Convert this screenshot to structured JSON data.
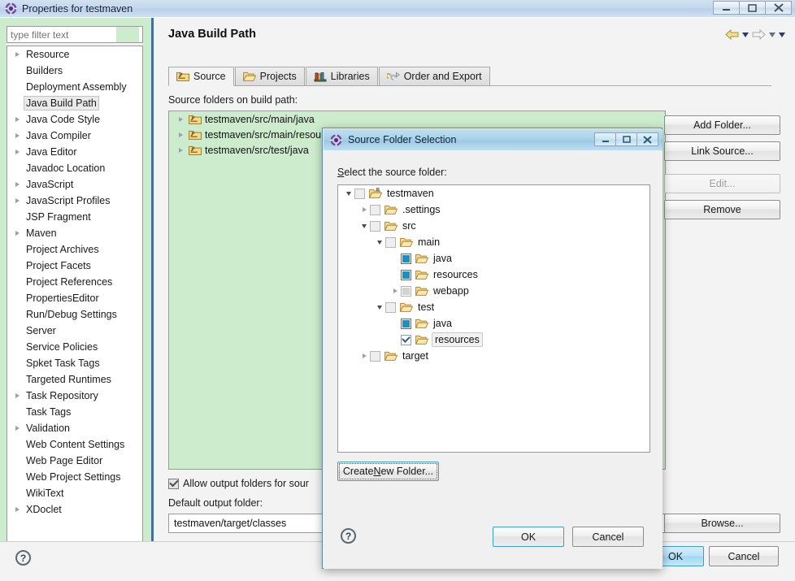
{
  "window": {
    "title": "Properties for testmaven",
    "icon": "eclipse-properties-icon",
    "minimize": "–",
    "maximize": "□",
    "close": "✕"
  },
  "filter": {
    "placeholder": "type filter text",
    "value": ""
  },
  "sidebar": {
    "items": [
      {
        "label": "Resource",
        "expandable": true,
        "selected": false
      },
      {
        "label": "Builders",
        "expandable": false,
        "selected": false
      },
      {
        "label": "Deployment Assembly",
        "expandable": false,
        "selected": false
      },
      {
        "label": "Java Build Path",
        "expandable": false,
        "selected": true
      },
      {
        "label": "Java Code Style",
        "expandable": true,
        "selected": false
      },
      {
        "label": "Java Compiler",
        "expandable": true,
        "selected": false
      },
      {
        "label": "Java Editor",
        "expandable": true,
        "selected": false
      },
      {
        "label": "Javadoc Location",
        "expandable": false,
        "selected": false
      },
      {
        "label": "JavaScript",
        "expandable": true,
        "selected": false
      },
      {
        "label": "JavaScript Profiles",
        "expandable": true,
        "selected": false
      },
      {
        "label": "JSP Fragment",
        "expandable": false,
        "selected": false
      },
      {
        "label": "Maven",
        "expandable": true,
        "selected": false
      },
      {
        "label": "Project Archives",
        "expandable": false,
        "selected": false
      },
      {
        "label": "Project Facets",
        "expandable": false,
        "selected": false
      },
      {
        "label": "Project References",
        "expandable": false,
        "selected": false
      },
      {
        "label": "PropertiesEditor",
        "expandable": false,
        "selected": false
      },
      {
        "label": "Run/Debug Settings",
        "expandable": false,
        "selected": false
      },
      {
        "label": "Server",
        "expandable": false,
        "selected": false
      },
      {
        "label": "Service Policies",
        "expandable": false,
        "selected": false
      },
      {
        "label": "Spket Task Tags",
        "expandable": false,
        "selected": false
      },
      {
        "label": "Targeted Runtimes",
        "expandable": false,
        "selected": false
      },
      {
        "label": "Task Repository",
        "expandable": true,
        "selected": false
      },
      {
        "label": "Task Tags",
        "expandable": false,
        "selected": false
      },
      {
        "label": "Validation",
        "expandable": true,
        "selected": false
      },
      {
        "label": "Web Content Settings",
        "expandable": false,
        "selected": false
      },
      {
        "label": "Web Page Editor",
        "expandable": false,
        "selected": false
      },
      {
        "label": "Web Project Settings",
        "expandable": false,
        "selected": false
      },
      {
        "label": "WikiText",
        "expandable": false,
        "selected": false
      },
      {
        "label": "XDoclet",
        "expandable": true,
        "selected": false
      }
    ]
  },
  "page": {
    "title": "Java Build Path",
    "nav": {
      "back_icon": "back-arrow-icon",
      "back_menu_icon": "chevron-down-icon",
      "forward_icon": "forward-arrow-icon",
      "forward_menu_icon": "chevron-down-icon",
      "view_menu_icon": "chevron-down-icon"
    },
    "tabs": [
      {
        "label": "Source",
        "icon": "source-folder-icon",
        "active": true
      },
      {
        "label": "Projects",
        "icon": "projects-icon",
        "active": false
      },
      {
        "label": "Libraries",
        "icon": "libraries-icon",
        "active": false
      },
      {
        "label": "Order and Export",
        "icon": "order-export-icon",
        "active": false
      }
    ],
    "source_label": "Source folders on build path:",
    "source_folders": [
      {
        "path": "testmaven/src/main/java",
        "icon": "source-folder-icon"
      },
      {
        "path": "testmaven/src/main/resources",
        "icon": "source-folder-icon"
      },
      {
        "path": "testmaven/src/test/java",
        "icon": "source-folder-icon"
      }
    ],
    "allow_output_label": "Allow output folders for sour",
    "allow_output_checked": true,
    "default_output_label": "Default output folder:",
    "default_output_value": "testmaven/target/classes",
    "buttons": {
      "add_folder": "Add Folder...",
      "link_source": "Link Source...",
      "edit": "Edit...",
      "edit_disabled": true,
      "remove": "Remove",
      "browse": "Browse..."
    }
  },
  "footer": {
    "help_icon": "help-icon",
    "help_glyph": "?",
    "ok": "OK",
    "cancel": "Cancel"
  },
  "dialog": {
    "title": "Source Folder Selection",
    "icon": "eclipse-properties-icon",
    "minimize": "–",
    "maximize": "□",
    "close": "✕",
    "prompt_accel": "S",
    "prompt_rest": "elect the source folder:",
    "tree": [
      {
        "label": "testmaven",
        "depth": 0,
        "twisty": "down",
        "check": "empty-gray",
        "icon": "project-folder-icon",
        "selected": false
      },
      {
        "label": ".settings",
        "depth": 1,
        "twisty": "right",
        "check": "empty-gray",
        "icon": "folder-icon",
        "selected": false
      },
      {
        "label": "src",
        "depth": 1,
        "twisty": "down",
        "check": "empty-gray",
        "icon": "folder-icon",
        "selected": false
      },
      {
        "label": "main",
        "depth": 2,
        "twisty": "down",
        "check": "empty-gray",
        "icon": "folder-icon",
        "selected": false
      },
      {
        "label": "java",
        "depth": 3,
        "twisty": "none",
        "check": "filled",
        "icon": "folder-icon",
        "selected": false
      },
      {
        "label": "resources",
        "depth": 3,
        "twisty": "none",
        "check": "filled",
        "icon": "folder-icon",
        "selected": false
      },
      {
        "label": "webapp",
        "depth": 3,
        "twisty": "right",
        "check": "grayfill",
        "icon": "folder-icon",
        "selected": false
      },
      {
        "label": "test",
        "depth": 2,
        "twisty": "down",
        "check": "empty-gray",
        "icon": "folder-icon",
        "selected": false
      },
      {
        "label": "java",
        "depth": 3,
        "twisty": "none",
        "check": "filled",
        "icon": "folder-icon",
        "selected": false
      },
      {
        "label": "resources",
        "depth": 3,
        "twisty": "none",
        "check": "checked",
        "icon": "folder-icon",
        "selected": true
      },
      {
        "label": "target",
        "depth": 1,
        "twisty": "right",
        "check": "empty-gray",
        "icon": "folder-icon",
        "selected": false
      }
    ],
    "create_new_folder_pre": "Create ",
    "create_new_folder_accel": "N",
    "create_new_folder_post": "ew Folder...",
    "help_glyph": "?",
    "ok": "OK",
    "cancel": "Cancel"
  },
  "colors": {
    "theme_green": "#cdeccd",
    "accent_blue": "#3c9fd4",
    "title_blue": "#a9d3ea",
    "checkbox_fill": "#1a8fc1",
    "folder_yellow": "#f5c96a"
  }
}
